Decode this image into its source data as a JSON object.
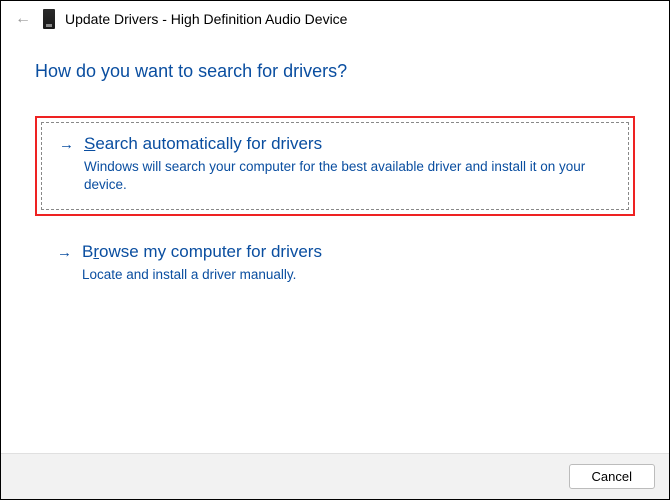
{
  "titlebar": {
    "title": "Update Drivers - High Definition Audio Device"
  },
  "heading": "How do you want to search for drivers?",
  "options": [
    {
      "title_pre": "",
      "mnemonic": "S",
      "title_post": "earch automatically for drivers",
      "desc": "Windows will search your computer for the best available driver and install it on your device."
    },
    {
      "title_pre": "B",
      "mnemonic": "r",
      "title_post": "owse my computer for drivers",
      "desc": "Locate and install a driver manually."
    }
  ],
  "footer": {
    "cancel": "Cancel"
  }
}
